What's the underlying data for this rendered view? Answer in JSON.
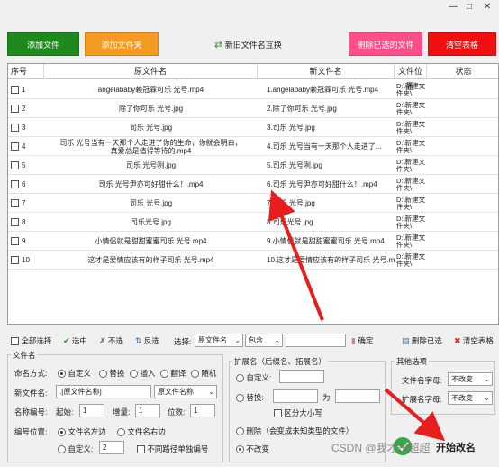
{
  "toolbar": {
    "add_file": "添加文件",
    "add_folder": "添加文件夹",
    "swap_names": "新旧文件名互换",
    "delete_selected": "删除已选的文件",
    "clear_table": "清空表格",
    "colors": {
      "add_file": "#1e8a1e",
      "add_folder": "#f59a23",
      "delete_selected": "#ff4f8b",
      "clear_table": "#f01010"
    }
  },
  "table": {
    "headers": [
      "序号",
      "原文件名",
      "新文件名",
      "文件位置",
      "状态"
    ],
    "rows": [
      {
        "idx": "1",
        "orig": "angelababy赖冠霖可乐  光号.mp4",
        "new": "1.angelababy赖冠霖可乐  光号.mp4",
        "loc": "D:\\新建文件夹\\"
      },
      {
        "idx": "2",
        "orig": "除了你可乐  光号.jpg",
        "new": "2.除了你可乐  光号.jpg",
        "loc": "D:\\新建文件夹\\"
      },
      {
        "idx": "3",
        "orig": "司乐  光号.jpg",
        "new": "3.司乐  光号.jpg",
        "loc": "D:\\新建文件夹\\"
      },
      {
        "idx": "4",
        "orig": "司乐  光号当有一天那个人走进了你的生命，你就会明白，真爱总是值得等待的.mp4",
        "orig_line1": "司乐  光号当有一天那个人走进了你的生命，你就会明白，",
        "orig_line2": "真爱总是值得等待的.mp4",
        "new": "4.司乐  光号当有一天那个人走进了...",
        "loc": "D:\\新建文件夹\\"
      },
      {
        "idx": "5",
        "orig": "司乐  光号咧.jpg",
        "new": "5.司乐  光号咧.jpg",
        "loc": "D:\\新建文件夹\\"
      },
      {
        "idx": "6",
        "orig": "司乐  光号尹亦可好甜什么！.mp4",
        "new": "6.司乐  光号尹亦可好甜什么！.mp4",
        "loc": "D:\\新建文件夹\\"
      },
      {
        "idx": "7",
        "orig": "司乐  光号.jpg",
        "new": "7.司乐  光号.jpg",
        "loc": "D:\\新建文件夹\\"
      },
      {
        "idx": "8",
        "orig": "司乐光号.jpg",
        "new": "8.司乐光号.jpg",
        "loc": "D:\\新建文件夹\\"
      },
      {
        "idx": "9",
        "orig": "小情侣就是甜甜蜜蜜司乐  光号.mp4",
        "new": "9.小情侣就是甜甜蜜蜜司乐  光号.mp4",
        "loc": "D:\\新建文件夹\\"
      },
      {
        "idx": "10",
        "orig": "这才是爱情应该有的样子司乐  光号.mp4",
        "new": "10.这才是爱情应该有的样子司乐  光号.mp4",
        "loc": "D:\\新建文件夹\\"
      }
    ]
  },
  "selbar": {
    "select_all": "全部选择",
    "check": "选中",
    "uncheck": "不选",
    "invert": "反选",
    "select_label": "选择:",
    "field_value": "原文件名",
    "mode_value": "包含",
    "confirm": "确定",
    "delete_checked": "删除已选",
    "clear_table": "清空表格"
  },
  "filename_group": {
    "title": "文件名",
    "naming_label": "命名方式:",
    "modes": [
      "自定义",
      "替换",
      "插入",
      "翻译",
      "随机"
    ],
    "newname_label": "新文件名:",
    "newname_value": ".[原文件名称]",
    "newname_combo": "原文件名称",
    "numbering_label": "名称编号:",
    "start_label": "起始:",
    "start_value": "1",
    "step_label": "增量:",
    "step_value": "1",
    "digits_label": "位数:",
    "digits_value": "1",
    "position_label": "编号位置:",
    "pos_left": "文件名左边",
    "pos_right": "文件名右边",
    "custom_label": "自定义:",
    "custom_value": "2",
    "separate_label": "不同路径单独编号"
  },
  "ext_group": {
    "title": "扩展名（后缀名、拓展名）",
    "custom_label": "自定义:",
    "replace_label": "替换:",
    "as_label": "为",
    "case_label": "区分大小写",
    "delete_label": "删除（会变成未知类型的文件）",
    "nochange_label": "不改变"
  },
  "other_group": {
    "title": "其他选项",
    "name_case_label": "文件名字母:",
    "name_case_value": "不改变",
    "ext_case_label": "扩展名字母:",
    "ext_case_value": "不改变"
  },
  "start_button": "开始改名",
  "watermark": "CSDN @我才是超超"
}
